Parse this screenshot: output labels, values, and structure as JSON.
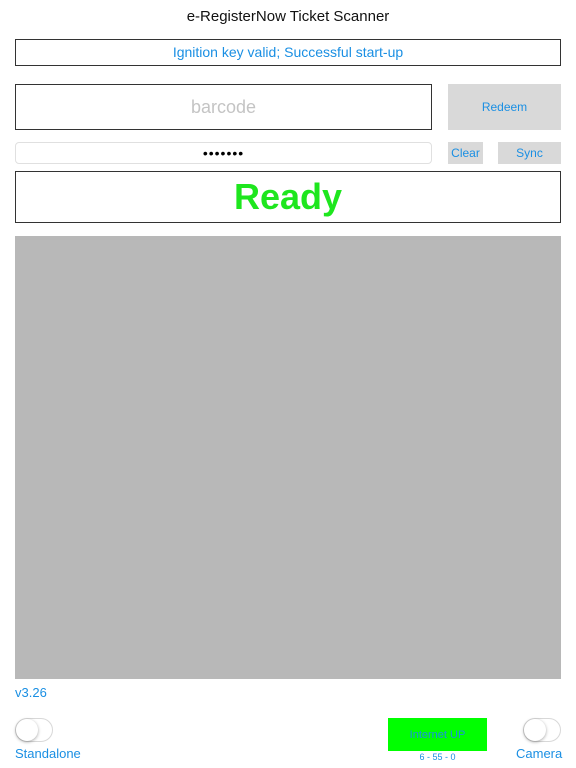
{
  "app": {
    "title": "e-RegisterNow Ticket Scanner"
  },
  "status": {
    "message": "Ignition key valid; Successful start-up"
  },
  "barcode": {
    "placeholder": "barcode",
    "value": ""
  },
  "password": {
    "value": "•••••••"
  },
  "buttons": {
    "redeem": "Redeem",
    "clear": "Clear",
    "sync": "Sync",
    "internet": "Internet UP"
  },
  "scan_state": {
    "text": "Ready",
    "color": "#1ee61e"
  },
  "footer": {
    "version": "v3.26",
    "standalone_label": "Standalone",
    "camera_label": "Camera",
    "standalone_on": false,
    "camera_on": false,
    "counts": "6 - 55 - 0"
  },
  "colors": {
    "accent": "#1a8fe3",
    "button_bg": "#d9d9d9",
    "internet_up": "#00ff00",
    "camera_bg": "#b8b8b8"
  }
}
